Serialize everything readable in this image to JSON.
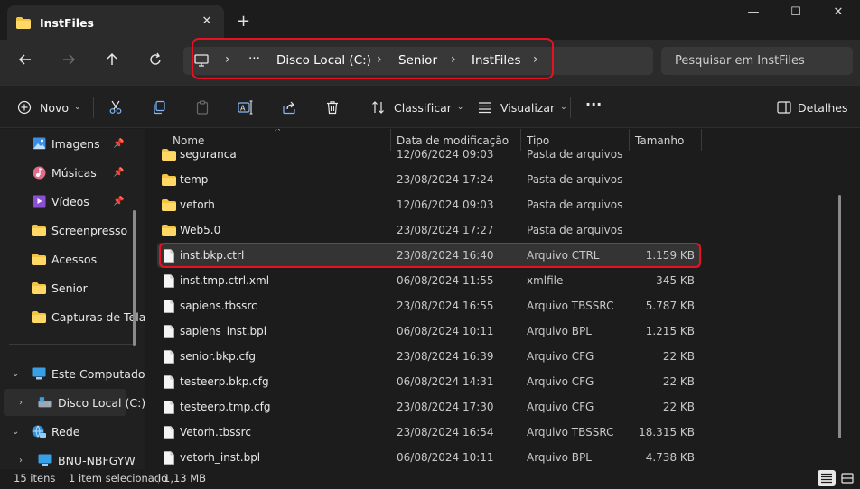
{
  "window": {
    "tab_title": "InstFiles",
    "tab_close": "✕",
    "new_tab": "+",
    "minimize": "—",
    "maximize": "☐",
    "close": "✕"
  },
  "address": {
    "segments": [
      "Disco Local (C:)",
      "Senior",
      "InstFiles"
    ],
    "overflow": "···",
    "separator": "›"
  },
  "search": {
    "placeholder": "Pesquisar em InstFiles"
  },
  "toolbar": {
    "new_label": "Novo",
    "sort_label": "Classificar",
    "view_label": "Visualizar",
    "more_label": "···",
    "details_label": "Detalhes"
  },
  "sidebar": {
    "quick": [
      {
        "label": "Imagens",
        "icon": "pictures-icon",
        "pinned": true
      },
      {
        "label": "Músicas",
        "icon": "music-icon",
        "pinned": true
      },
      {
        "label": "Vídeos",
        "icon": "videos-icon",
        "pinned": true
      },
      {
        "label": "Screenpresso",
        "icon": "folder-icon",
        "pinned": false
      },
      {
        "label": "Acessos",
        "icon": "folder-icon",
        "pinned": false
      },
      {
        "label": "Senior",
        "icon": "folder-icon",
        "pinned": false
      },
      {
        "label": "Capturas de Tela",
        "icon": "folder-icon",
        "pinned": false
      }
    ],
    "tree": [
      {
        "label": "Este Computador",
        "icon": "computer-icon",
        "expanded": true
      },
      {
        "label": "Disco Local (C:)",
        "icon": "drive-icon",
        "expanded": false
      },
      {
        "label": "Rede",
        "icon": "network-icon",
        "expanded": true
      },
      {
        "label": "BNU-NBFGYW",
        "icon": "computer-icon",
        "expanded": false
      }
    ],
    "pin_glyph": "📌"
  },
  "columns": {
    "name": "Nome",
    "date": "Data de modificação",
    "type": "Tipo",
    "size": "Tamanho"
  },
  "files": [
    {
      "name": "seguranca",
      "date": "12/06/2024 09:03",
      "type": "Pasta de arquivos",
      "size": "",
      "kind": "folder"
    },
    {
      "name": "temp",
      "date": "23/08/2024 17:24",
      "type": "Pasta de arquivos",
      "size": "",
      "kind": "folder"
    },
    {
      "name": "vetorh",
      "date": "12/06/2024 09:03",
      "type": "Pasta de arquivos",
      "size": "",
      "kind": "folder"
    },
    {
      "name": "Web5.0",
      "date": "23/08/2024 17:27",
      "type": "Pasta de arquivos",
      "size": "",
      "kind": "folder"
    },
    {
      "name": "inst.bkp.ctrl",
      "date": "23/08/2024 16:40",
      "type": "Arquivo CTRL",
      "size": "1.159 KB",
      "kind": "file",
      "selected": true
    },
    {
      "name": "inst.tmp.ctrl.xml",
      "date": "06/08/2024 11:55",
      "type": "xmlfile",
      "size": "345 KB",
      "kind": "file"
    },
    {
      "name": "sapiens.tbssrc",
      "date": "23/08/2024 16:55",
      "type": "Arquivo TBSSRC",
      "size": "5.787 KB",
      "kind": "file"
    },
    {
      "name": "sapiens_inst.bpl",
      "date": "06/08/2024 10:11",
      "type": "Arquivo BPL",
      "size": "1.215 KB",
      "kind": "file"
    },
    {
      "name": "senior.bkp.cfg",
      "date": "23/08/2024 16:39",
      "type": "Arquivo CFG",
      "size": "22 KB",
      "kind": "file"
    },
    {
      "name": "testeerp.bkp.cfg",
      "date": "06/08/2024 14:31",
      "type": "Arquivo CFG",
      "size": "22 KB",
      "kind": "file"
    },
    {
      "name": "testeerp.tmp.cfg",
      "date": "23/08/2024 17:30",
      "type": "Arquivo CFG",
      "size": "22 KB",
      "kind": "file"
    },
    {
      "name": "Vetorh.tbssrc",
      "date": "23/08/2024 16:54",
      "type": "Arquivo TBSSRC",
      "size": "18.315 KB",
      "kind": "file"
    },
    {
      "name": "vetorh_inst.bpl",
      "date": "06/08/2024 10:11",
      "type": "Arquivo BPL",
      "size": "4.738 KB",
      "kind": "file"
    }
  ],
  "status": {
    "count": "15 itens",
    "selection": "1 item selecionado",
    "selection_size": "1,13 MB"
  },
  "colors": {
    "highlight": "#e81123",
    "folder": "#f4c542",
    "background": "#1c1c1c"
  }
}
